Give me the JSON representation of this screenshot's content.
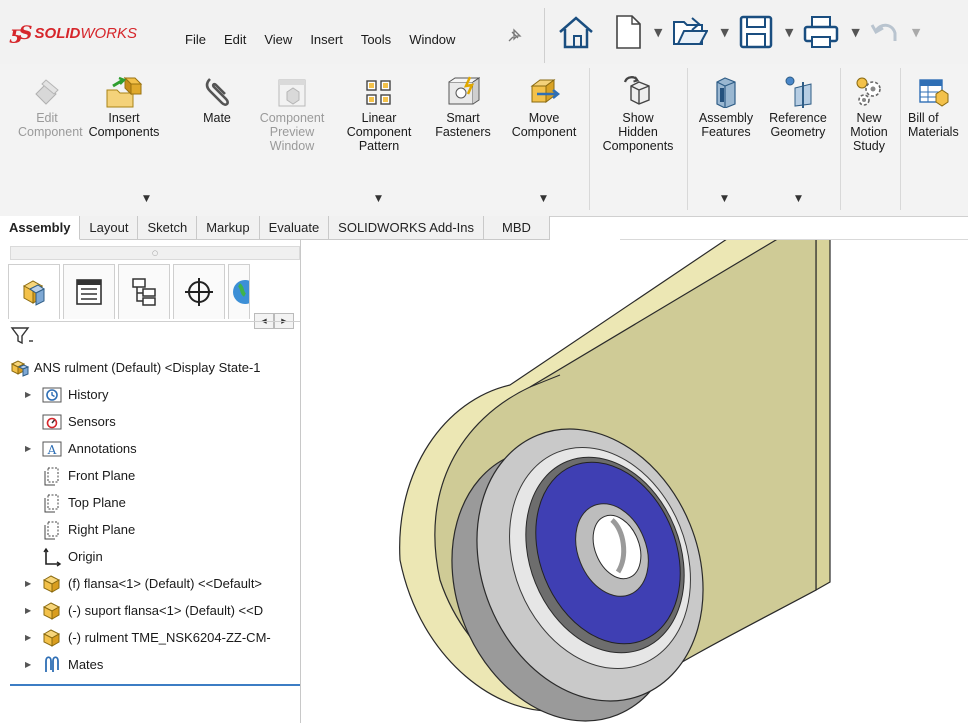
{
  "app": {
    "logo_ds": "ƽS",
    "logo_solid": "SOLID",
    "logo_works": "WORKS"
  },
  "menu": [
    "File",
    "Edit",
    "View",
    "Insert",
    "Tools",
    "Window"
  ],
  "ribbon": {
    "commands": [
      {
        "label": "Edit\nComponent",
        "icon": "edit-component-icon",
        "enabled": false
      },
      {
        "label": "Insert\nComponents",
        "icon": "insert-components-icon",
        "enabled": true
      },
      {
        "label": "Mate",
        "icon": "mate-paperclip-icon",
        "enabled": true
      },
      {
        "label": "Component\nPreview\nWindow",
        "icon": "component-preview-icon",
        "enabled": false
      },
      {
        "label": "Linear\nComponent\nPattern",
        "icon": "linear-pattern-icon",
        "enabled": true
      },
      {
        "label": "Smart\nFasteners",
        "icon": "smart-fasteners-icon",
        "enabled": true
      },
      {
        "label": "Move\nComponent",
        "icon": "move-component-icon",
        "enabled": true
      },
      {
        "label": "Show\nHidden\nComponents",
        "icon": "show-hidden-icon",
        "enabled": true
      },
      {
        "label": "Assembly\nFeatures",
        "icon": "assembly-features-icon",
        "enabled": true
      },
      {
        "label": "Reference\nGeometry",
        "icon": "reference-geometry-icon",
        "enabled": true
      },
      {
        "label": "New\nMotion\nStudy",
        "icon": "motion-study-icon",
        "enabled": true
      },
      {
        "label": "Bill of\nMaterials",
        "icon": "bom-icon",
        "enabled": true
      }
    ]
  },
  "tabs": [
    {
      "label": "Assembly",
      "active": true
    },
    {
      "label": "Layout",
      "active": false
    },
    {
      "label": "Sketch",
      "active": false
    },
    {
      "label": "Markup",
      "active": false
    },
    {
      "label": "Evaluate",
      "active": false
    },
    {
      "label": "SOLIDWORKS Add-Ins",
      "active": false
    },
    {
      "label": "MBD",
      "active": false
    }
  ],
  "tree": {
    "root": "ANS rulment (Default) <Display State-1",
    "items": [
      {
        "label": "History",
        "icon": "history-folder-icon",
        "expandable": true
      },
      {
        "label": "Sensors",
        "icon": "sensors-folder-icon",
        "expandable": false
      },
      {
        "label": "Annotations",
        "icon": "annotations-folder-icon",
        "expandable": true
      },
      {
        "label": "Front Plane",
        "icon": "plane-icon",
        "expandable": false
      },
      {
        "label": "Top Plane",
        "icon": "plane-icon",
        "expandable": false
      },
      {
        "label": "Right Plane",
        "icon": "plane-icon",
        "expandable": false
      },
      {
        "label": "Origin",
        "icon": "origin-icon",
        "expandable": false
      },
      {
        "label": "(f) flansa<1> (Default) <<Default>",
        "icon": "part-icon",
        "expandable": true
      },
      {
        "label": "(-) suport flansa<1> (Default) <<D",
        "icon": "part-icon",
        "expandable": true
      },
      {
        "label": "(-) rulment TME_NSK6204-ZZ-CM-",
        "icon": "part-icon",
        "expandable": true
      },
      {
        "label": "Mates",
        "icon": "mates-icon",
        "expandable": true
      }
    ]
  }
}
